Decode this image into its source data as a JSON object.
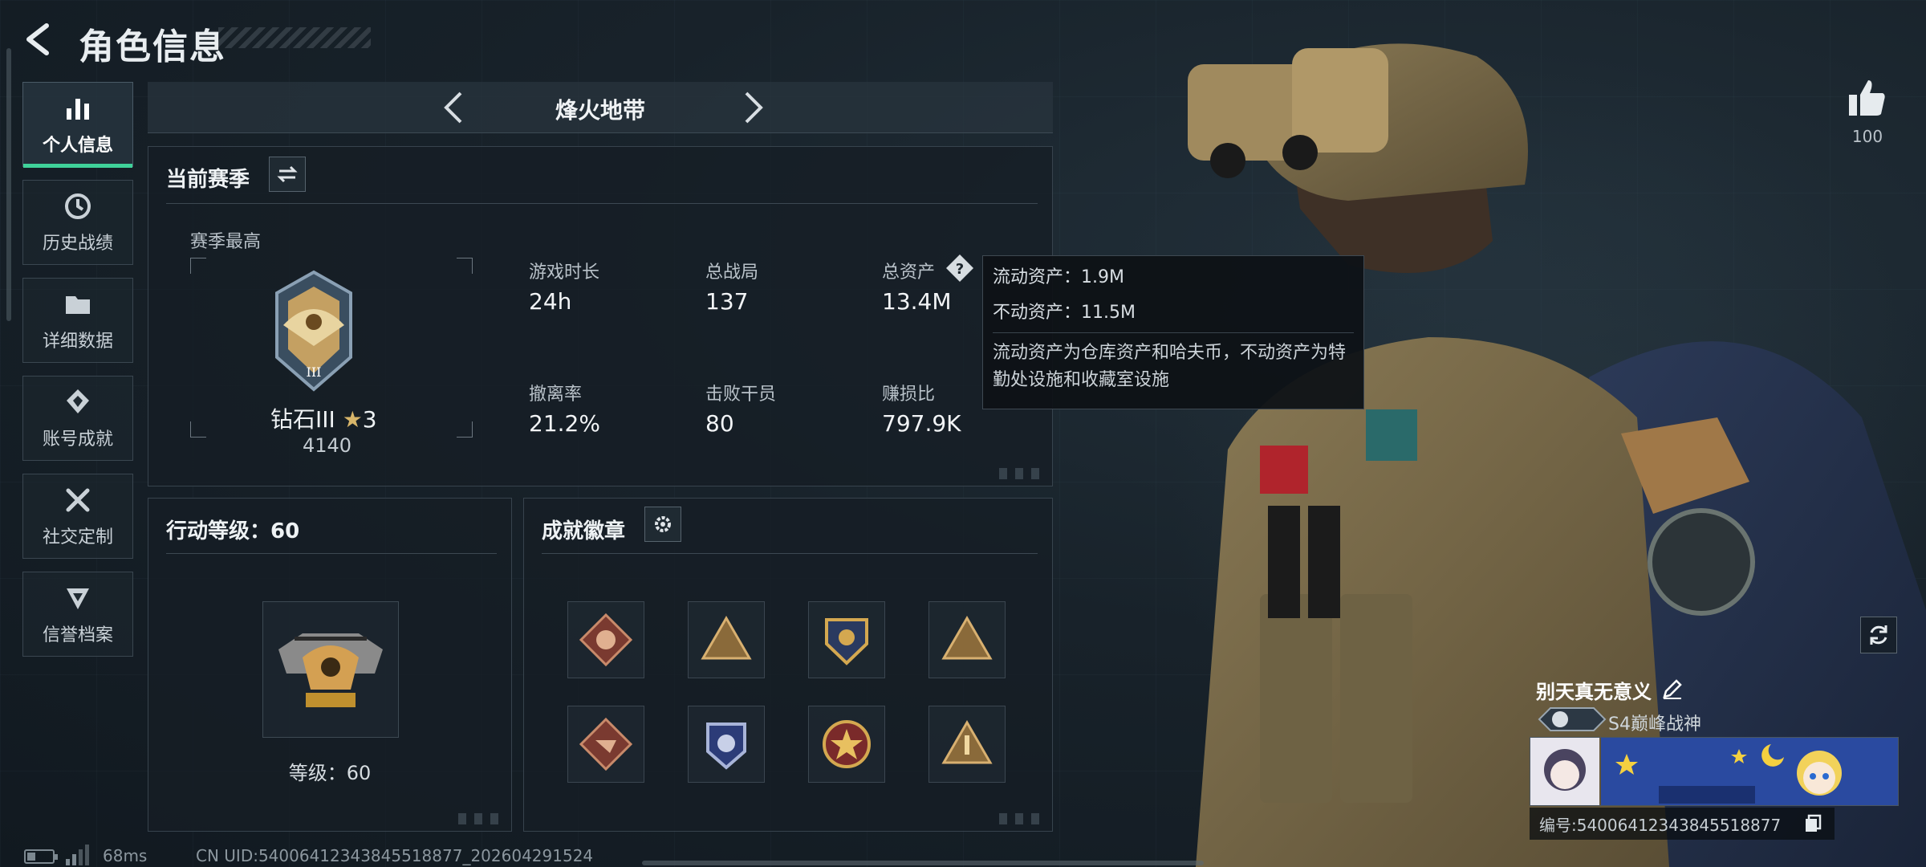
{
  "header": {
    "title": "角色信息"
  },
  "nav": [
    {
      "label": "个人信息",
      "icon": "bar-chart-icon",
      "active": true
    },
    {
      "label": "历史战绩",
      "icon": "clock-history-icon",
      "active": false
    },
    {
      "label": "详细数据",
      "icon": "folder-icon",
      "active": false
    },
    {
      "label": "账号成就",
      "icon": "achievement-icon",
      "active": false
    },
    {
      "label": "社交定制",
      "icon": "tools-icon",
      "active": false
    },
    {
      "label": "信誉档案",
      "icon": "reputation-icon",
      "active": false
    }
  ],
  "mode": {
    "title": "烽火地带"
  },
  "season": {
    "title": "当前赛季",
    "best_label": "赛季最高",
    "rank_name": "钻石III",
    "rank_stars": "3",
    "rank_points": "4140",
    "stats": [
      {
        "label": "游戏时长",
        "value": "24h"
      },
      {
        "label": "总战局",
        "value": "137"
      },
      {
        "label": "总资产",
        "value": "13.4M"
      },
      {
        "label": "撤离率",
        "value": "21.2%"
      },
      {
        "label": "击败干员",
        "value": "80"
      },
      {
        "label": "赚损比",
        "value": "797.9K"
      }
    ]
  },
  "tooltip": {
    "liquid": "流动资产：1.9M",
    "fixed": "不动资产：11.5M",
    "desc": "流动资产为仓库资产和哈夫币，不动资产为特勤处设施和收藏室设施"
  },
  "action_level": {
    "title": "行动等级：60",
    "level_text": "等级：60"
  },
  "badges": {
    "title": "成就徽章"
  },
  "profile": {
    "likes": "100",
    "name": "别天真无意义",
    "rank_title": "S4巅峰战神",
    "uid_label": "编号:5400641234384551887​7"
  },
  "footer": {
    "ping": "68ms",
    "cn_uid": "CN UID:5400641234384551887​7_202604291524"
  }
}
